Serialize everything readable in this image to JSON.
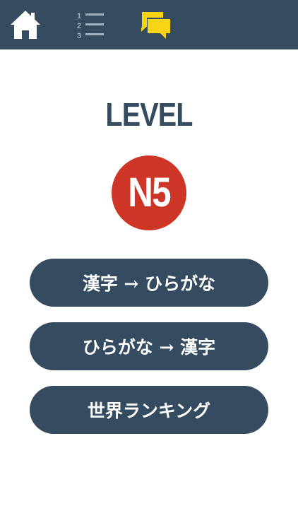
{
  "nav": {
    "home_icon": "home-icon",
    "list_icon": "numbered-list-icon",
    "list_numbers": [
      "1",
      "2",
      "3"
    ],
    "chat_icon": "chat-bubbles-icon",
    "bar_color": "#354b60",
    "chat_color": "#f7d416"
  },
  "level": {
    "title": "LEVEL",
    "badge": "N5",
    "badge_color": "#cd3526"
  },
  "menu": {
    "kanji_to_hiragana": "漢字 → ひらがな",
    "hiragana_to_kanji": "ひらがな → 漢字",
    "world_ranking": "世界ランキング"
  }
}
